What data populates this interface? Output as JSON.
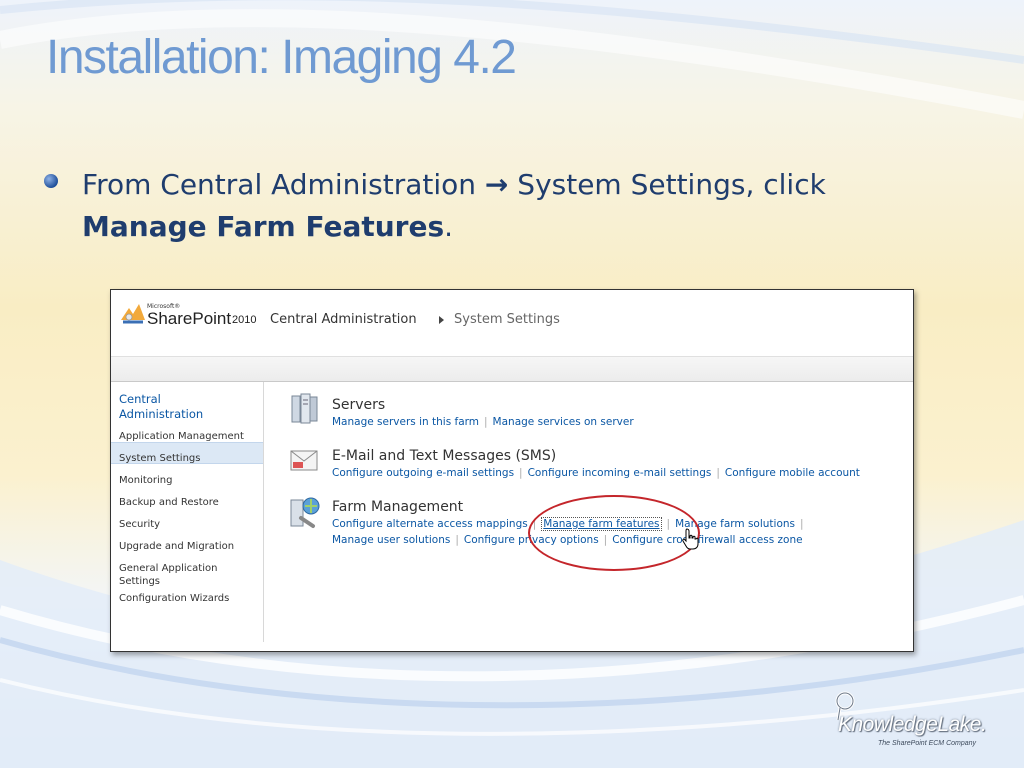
{
  "slide": {
    "title": "Installation: Imaging 4.2",
    "bullet": {
      "prefix": "From Central Administration ",
      "arrow": "→",
      "middle": " System Settings, click",
      "bold": "Manage Farm Features",
      "suffix": "."
    }
  },
  "sharepoint": {
    "brand_small": "Microsoft®",
    "brand": "SharePoint",
    "version": "2010",
    "breadcrumb": {
      "root": "Central Administration",
      "current": "System Settings"
    },
    "quick_launch": {
      "heading": "Central Administration",
      "items": [
        "Application Management",
        "System Settings",
        "Monitoring",
        "Backup and Restore",
        "Security",
        "Upgrade and Migration",
        "General Application Settings",
        "Configuration Wizards"
      ],
      "selected": "System Settings"
    },
    "sections": {
      "servers": {
        "title": "Servers",
        "links": [
          "Manage servers in this farm",
          "Manage services on server"
        ]
      },
      "email": {
        "title": "E-Mail and Text Messages (SMS)",
        "links": [
          "Configure outgoing e-mail settings",
          "Configure incoming e-mail settings",
          "Configure mobile account"
        ]
      },
      "farm": {
        "title": "Farm Management",
        "links_row1": [
          "Configure alternate access mappings",
          "Manage farm features",
          "Manage farm solutions"
        ],
        "links_row2": [
          "Manage user solutions",
          "Configure privacy options",
          "Configure cross-firewall access zone"
        ]
      }
    },
    "link_separator": "|"
  },
  "footer_logo": {
    "name": "KnowledgeLake.",
    "tagline": "The SharePoint ECM Company"
  },
  "colors": {
    "title": "#6f9ad2",
    "bullet_text": "#1f3d6e",
    "link": "#0b57a4",
    "highlight_oval": "#c4262b"
  }
}
